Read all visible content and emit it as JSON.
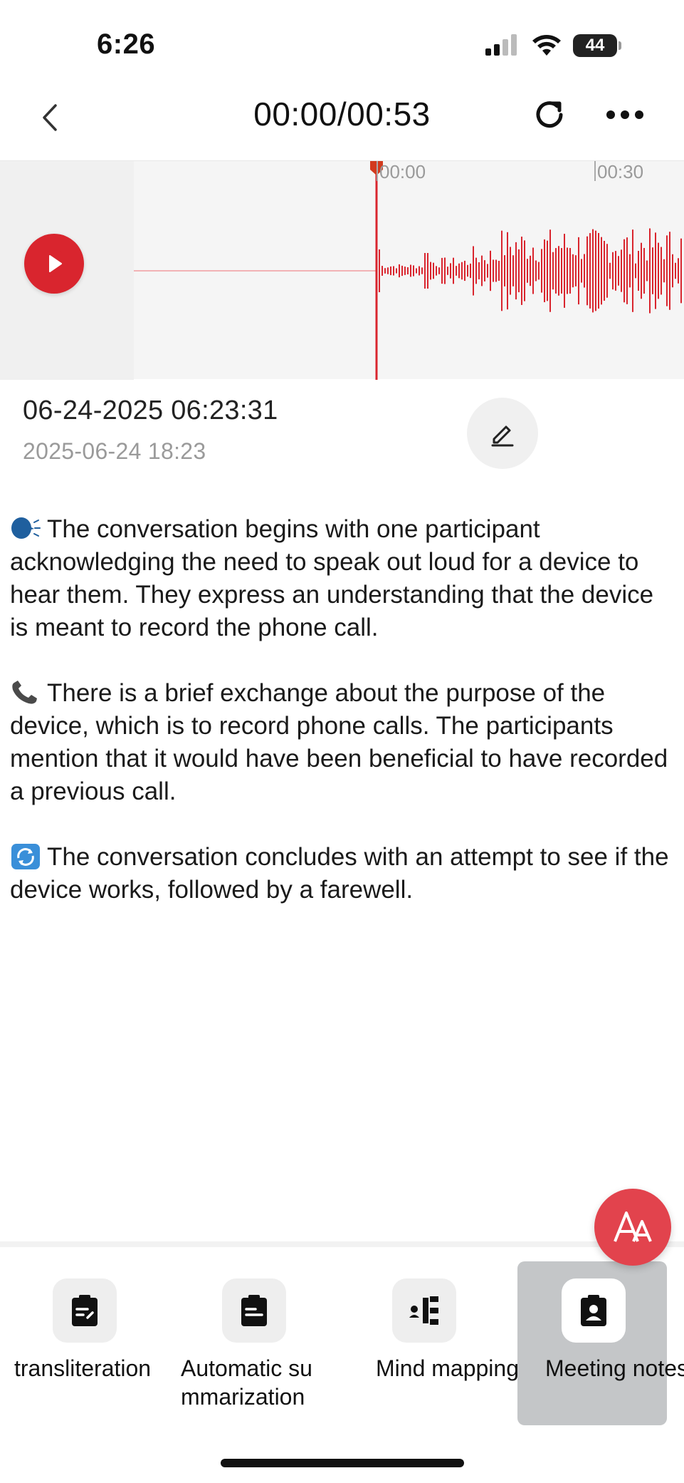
{
  "status_bar": {
    "time": "6:26",
    "battery": "44",
    "icons": [
      "signal-icon",
      "wifi-icon",
      "battery-icon"
    ]
  },
  "nav": {
    "playback_time": "00:00/00:53",
    "back_icon": "chevron-left-icon",
    "refresh_icon": "refresh-icon",
    "more_icon": "more-dots-icon"
  },
  "waveform": {
    "tick_labels": [
      "00:00",
      "00:30"
    ],
    "playhead_color": "#d9252e",
    "wave_color": "#d9252e"
  },
  "recording": {
    "title": "06-24-2025 06:23:31",
    "created": "2025-06-24 18:23"
  },
  "summary": {
    "paragraphs": [
      {
        "icon": "speaking-head-emoji",
        "text": "The conversation begins with one participant acknowledging the need to speak out loud for a device to hear them. They express an understanding that the device is meant to record the phone call."
      },
      {
        "icon": "telephone-receiver-emoji",
        "text": "There is a brief exchange about the purpose of the device, which is to record phone calls. The participants mention that it would have been beneficial to have recorded a previous call."
      },
      {
        "icon": "repeat-arrows-emoji",
        "text": "The conversation concludes with an attempt to see if the device works, followed by a farewell."
      }
    ]
  },
  "fab": {
    "icon": "font-size-icon",
    "color": "#e2434d"
  },
  "tools": [
    {
      "label": "transliteration",
      "icon": "clipboard-edit-icon",
      "active": false
    },
    {
      "label": "Automatic summarization",
      "icon": "clipboard-list-icon",
      "active": false
    },
    {
      "label": "Mind mapping",
      "icon": "mind-map-icon",
      "active": false
    },
    {
      "label": "Meeting notes",
      "icon": "clipboard-user-icon",
      "active": true
    }
  ],
  "colors": {
    "accent": "#d9252e",
    "active_tab_bg": "#c4c6c8"
  }
}
